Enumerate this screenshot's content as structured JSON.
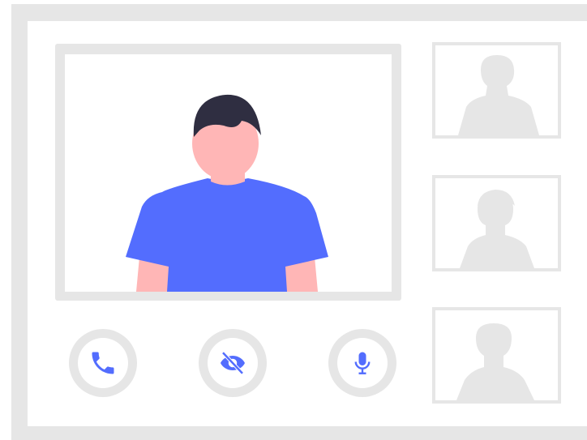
{
  "illustration": {
    "main_participant": {
      "hair_color": "#2f2e41",
      "skin_color": "#ffb6b6",
      "shirt_color": "#536dfe"
    },
    "thumbnail_count": 3,
    "placeholder_color": "#e6e6e6"
  },
  "controls": [
    {
      "icon": "phone-icon",
      "color": "#536dfe"
    },
    {
      "icon": "eye-slash-icon",
      "color": "#536dfe"
    },
    {
      "icon": "microphone-icon",
      "color": "#536dfe"
    }
  ]
}
